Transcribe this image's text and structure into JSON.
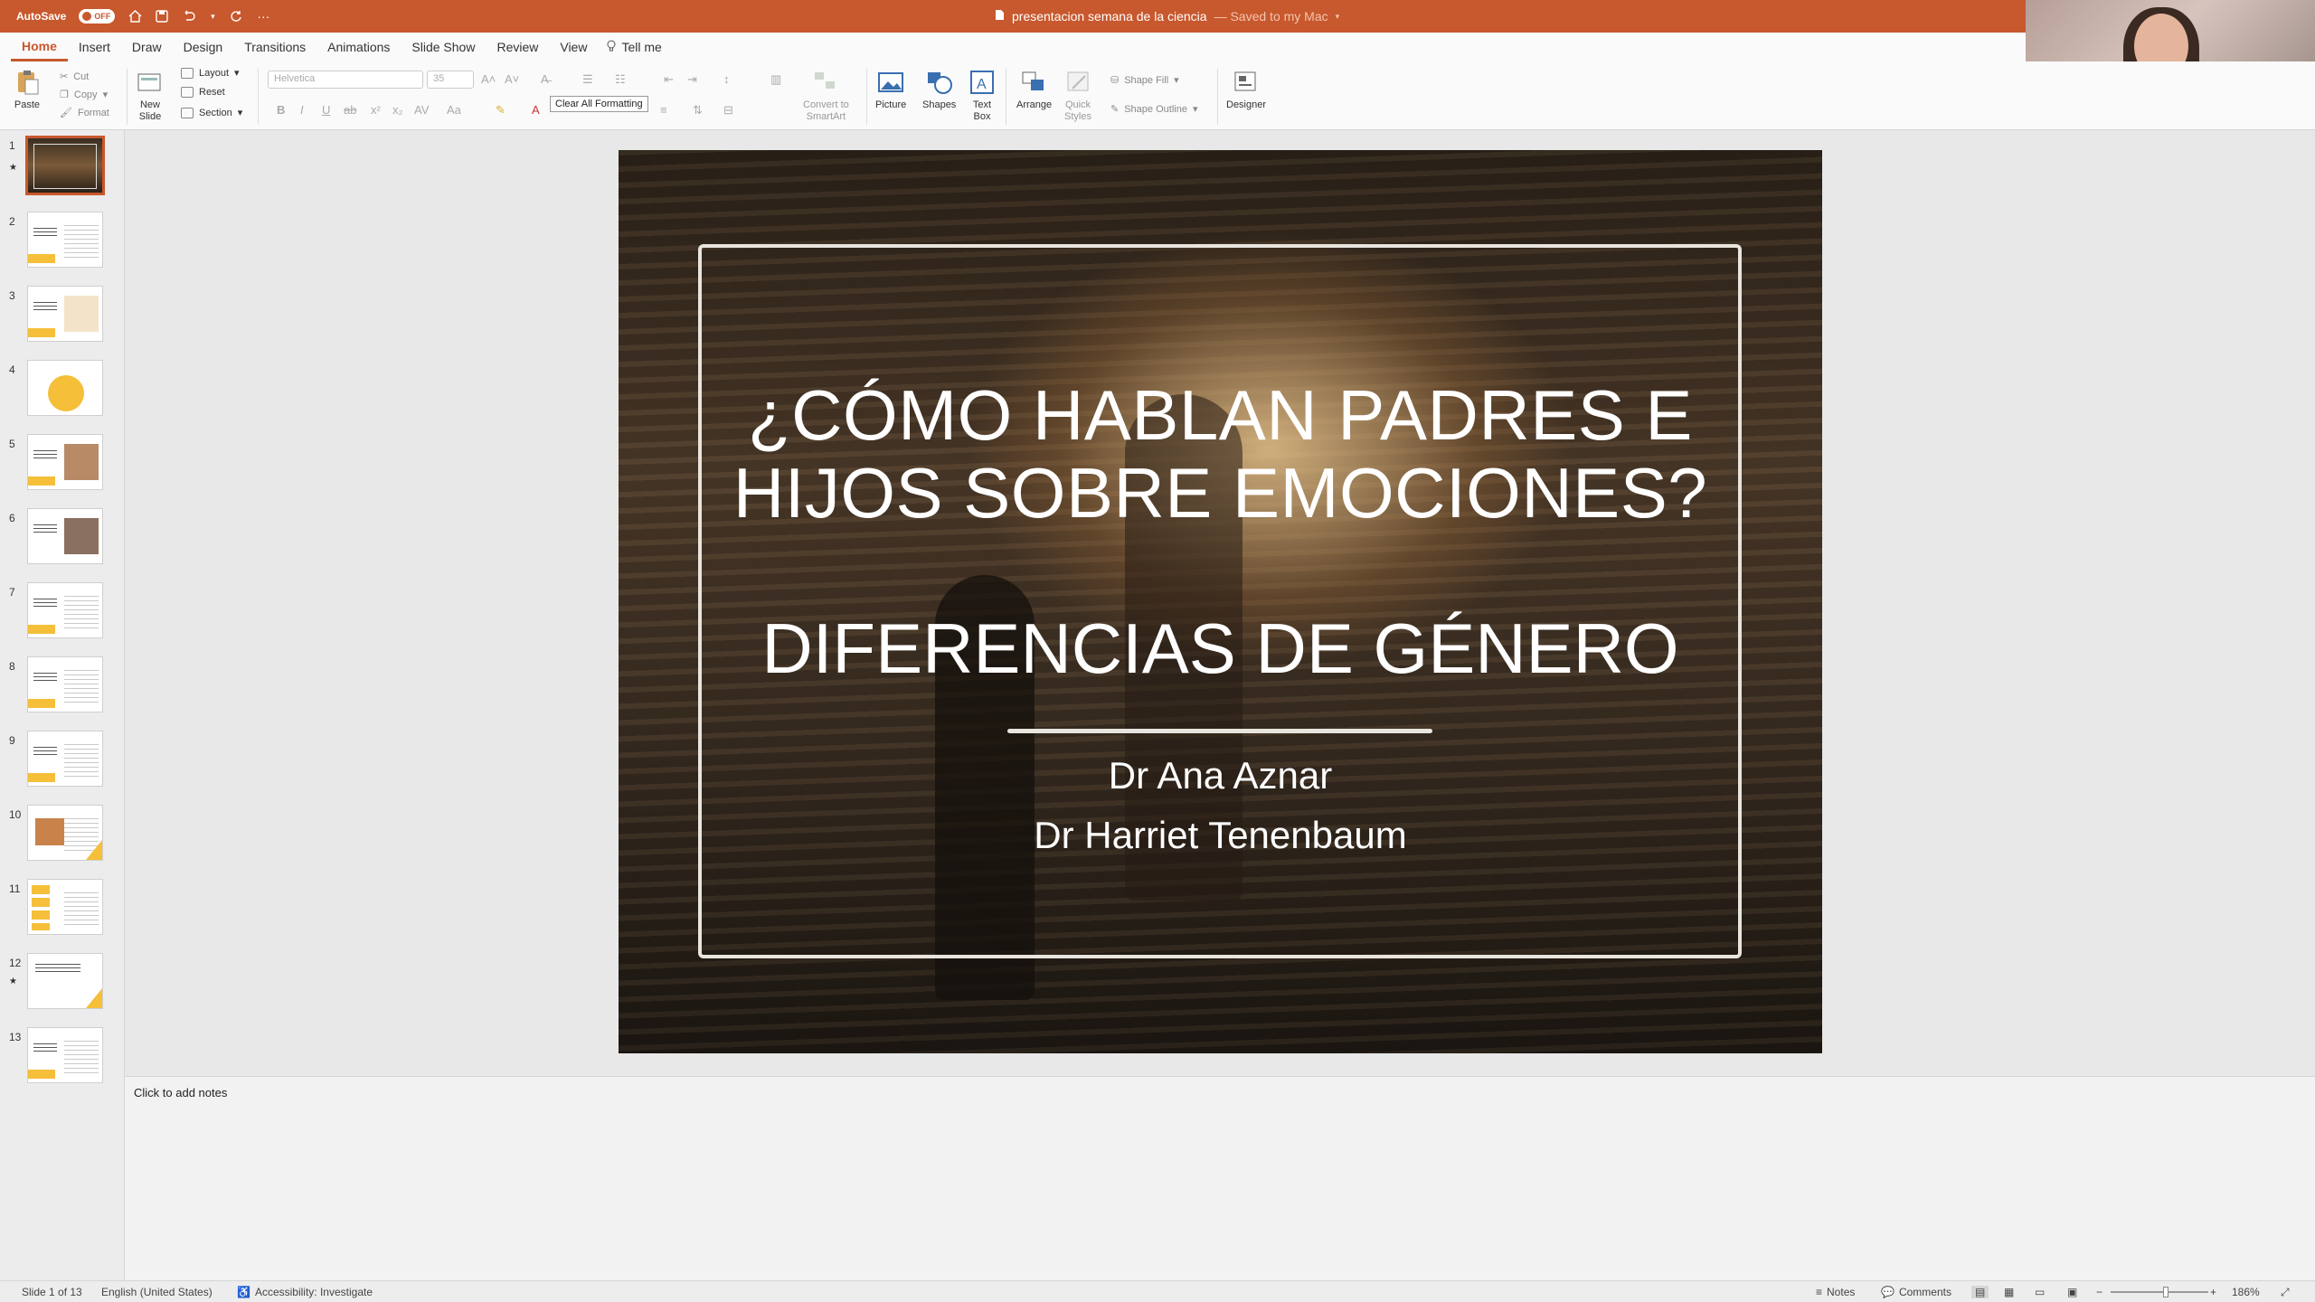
{
  "titlebar": {
    "autosave_label": "AutoSave",
    "autosave_state": "OFF",
    "document_title": "presentacion semana de la ciencia",
    "saved_status": "— Saved to my Mac"
  },
  "ribbon_tabs": [
    "Home",
    "Insert",
    "Draw",
    "Design",
    "Transitions",
    "Animations",
    "Slide Show",
    "Review",
    "View"
  ],
  "tell_me": "Tell me",
  "ribbon": {
    "paste": "Paste",
    "cut": "Cut",
    "copy": "Copy",
    "format": "Format",
    "new_slide": "New\nSlide",
    "layout": "Layout",
    "reset": "Reset",
    "section": "Section",
    "font_name": "Helvetica",
    "font_size": "35",
    "convert_smartart": "Convert to\nSmartArt",
    "picture": "Picture",
    "shapes": "Shapes",
    "text_box": "Text\nBox",
    "arrange": "Arrange",
    "quick_styles": "Quick\nStyles",
    "shape_fill": "Shape Fill",
    "shape_outline": "Shape Outline",
    "designer": "Designer",
    "tooltip": "Clear All Formatting"
  },
  "thumbnails": [
    "1",
    "2",
    "3",
    "4",
    "5",
    "6",
    "7",
    "8",
    "9",
    "10",
    "11",
    "12",
    "13"
  ],
  "slide": {
    "title_line1": "¿CÓMO HABLAN PADRES E",
    "title_line2": "HIJOS SOBRE EMOCIONES?",
    "subtitle": "DIFERENCIAS DE GÉNERO",
    "author1": "Dr Ana Aznar",
    "author2": "Dr Harriet Tenenbaum"
  },
  "notes_placeholder": "Click to add notes",
  "status": {
    "slide_count": "Slide 1 of 13",
    "language": "English (United States)",
    "accessibility": "Accessibility: Investigate",
    "notes": "Notes",
    "comments": "Comments",
    "zoom": "186%"
  },
  "colors": {
    "accent": "#c8582d",
    "thumbnail_yellow": "#f5bf3a"
  }
}
